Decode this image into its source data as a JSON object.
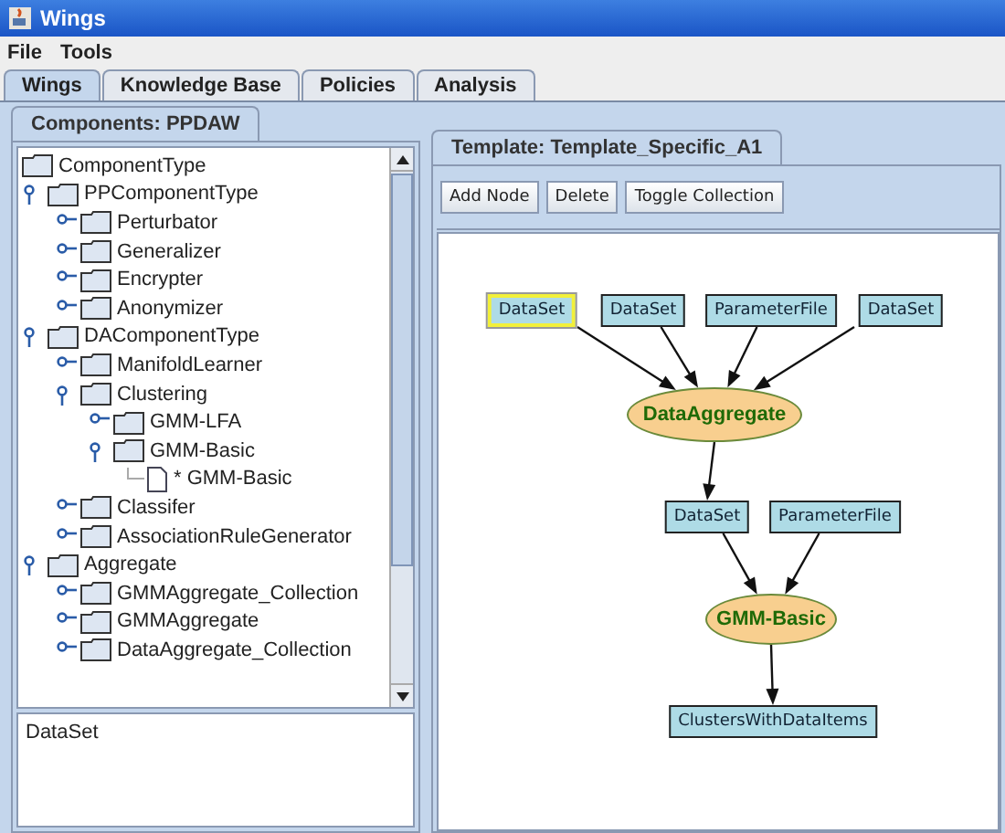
{
  "window": {
    "title": "Wings"
  },
  "menu": [
    "File",
    "Tools"
  ],
  "tabs": [
    {
      "label": "Wings",
      "selected": true
    },
    {
      "label": "Knowledge Base",
      "selected": false
    },
    {
      "label": "Policies",
      "selected": false
    },
    {
      "label": "Analysis",
      "selected": false
    }
  ],
  "components": {
    "tab": {
      "label": "Components: PPDAW",
      "selected": true
    },
    "tree": [
      {
        "label": "ComponentType",
        "kind": "folder",
        "children": [
          {
            "label": "PPComponentType",
            "kind": "folder",
            "expanded": true,
            "children": [
              {
                "label": "Perturbator",
                "kind": "folder",
                "expanded": false
              },
              {
                "label": "Generalizer",
                "kind": "folder",
                "expanded": false
              },
              {
                "label": "Encrypter",
                "kind": "folder",
                "expanded": false
              },
              {
                "label": "Anonymizer",
                "kind": "folder",
                "expanded": false
              }
            ]
          },
          {
            "label": "DAComponentType",
            "kind": "folder",
            "expanded": true,
            "children": [
              {
                "label": "ManifoldLearner",
                "kind": "folder",
                "expanded": false
              },
              {
                "label": "Clustering",
                "kind": "folder",
                "expanded": true,
                "children": [
                  {
                    "label": "GMM-LFA",
                    "kind": "folder",
                    "expanded": false
                  },
                  {
                    "label": "GMM-Basic",
                    "kind": "folder",
                    "expanded": true,
                    "children": [
                      {
                        "label": "* GMM-Basic",
                        "kind": "file"
                      }
                    ]
                  }
                ]
              },
              {
                "label": "Classifer",
                "kind": "folder",
                "expanded": false
              },
              {
                "label": "AssociationRuleGenerator",
                "kind": "folder",
                "expanded": false
              }
            ]
          },
          {
            "label": "Aggregate",
            "kind": "folder",
            "expanded": true,
            "children": [
              {
                "label": "GMMAggregate_Collection",
                "kind": "folder",
                "expanded": false
              },
              {
                "label": "GMMAggregate",
                "kind": "folder",
                "expanded": false
              },
              {
                "label": "DataAggregate_Collection",
                "kind": "folder",
                "expanded": false
              }
            ]
          }
        ]
      }
    ],
    "details": "DataSet"
  },
  "template": {
    "tab": {
      "label": "Template: Template_Specific_A1",
      "selected": true
    },
    "buttons": [
      "Add Node",
      "Delete",
      "Toggle Collection"
    ],
    "nodes": [
      {
        "label": "DataSet",
        "kind": "data",
        "selected": true
      },
      {
        "label": "DataSet",
        "kind": "data",
        "selected": false
      },
      {
        "label": "ParameterFile",
        "kind": "data",
        "selected": false
      },
      {
        "label": "DataSet",
        "kind": "data",
        "selected": false
      },
      {
        "label": "DataAggregate",
        "kind": "process",
        "selected": false
      },
      {
        "label": "DataSet",
        "kind": "data",
        "selected": false
      },
      {
        "label": "ParameterFile",
        "kind": "data",
        "selected": false
      },
      {
        "label": "GMM-Basic",
        "kind": "process",
        "selected": false
      },
      {
        "label": "ClustersWithDataItems",
        "kind": "data",
        "selected": false
      }
    ]
  }
}
